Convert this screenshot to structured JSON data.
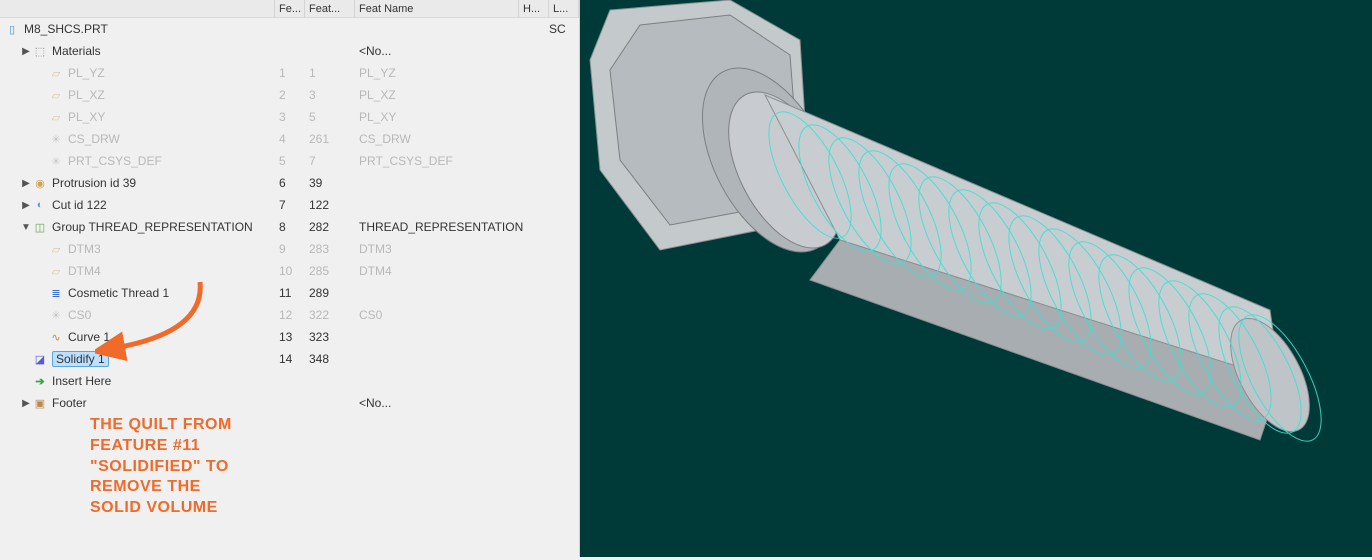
{
  "header": {
    "col_feat_num_abbrev": "Fe...",
    "col_feat_abbrev": "Feat...",
    "col_feat_name": "Feat Name",
    "col_h": "H...",
    "col_l": "L..."
  },
  "root": {
    "label": "M8_SHCS.PRT",
    "stat": "SC"
  },
  "tree": [
    {
      "id": "materials",
      "label": "Materials",
      "expand": "▶",
      "indent": 1,
      "icon": "mat",
      "dim": false,
      "c1": "",
      "c2": "",
      "c3": "<No...",
      "interactable": true
    },
    {
      "id": "pl_yz",
      "label": "PL_YZ",
      "expand": "",
      "indent": 2,
      "icon": "plane",
      "dim": true,
      "c1": "1",
      "c2": "1",
      "c3": "PL_YZ",
      "interactable": true
    },
    {
      "id": "pl_xz",
      "label": "PL_XZ",
      "expand": "",
      "indent": 2,
      "icon": "plane",
      "dim": true,
      "c1": "2",
      "c2": "3",
      "c3": "PL_XZ",
      "interactable": true
    },
    {
      "id": "pl_xy",
      "label": "PL_XY",
      "expand": "",
      "indent": 2,
      "icon": "plane",
      "dim": true,
      "c1": "3",
      "c2": "5",
      "c3": "PL_XY",
      "interactable": true
    },
    {
      "id": "cs_drw",
      "label": "CS_DRW",
      "expand": "",
      "indent": 2,
      "icon": "csys",
      "dim": true,
      "c1": "4",
      "c2": "261",
      "c3": "CS_DRW",
      "interactable": true
    },
    {
      "id": "prt_csys_def",
      "label": "PRT_CSYS_DEF",
      "expand": "",
      "indent": 2,
      "icon": "csys",
      "dim": true,
      "c1": "5",
      "c2": "7",
      "c3": "PRT_CSYS_DEF",
      "interactable": true
    },
    {
      "id": "protrusion39",
      "label": "Protrusion id 39",
      "expand": "▶",
      "indent": 1,
      "icon": "prot",
      "dim": false,
      "c1": "6",
      "c2": "39",
      "c3": "",
      "interactable": true
    },
    {
      "id": "cut122",
      "label": "Cut id 122",
      "expand": "▶",
      "indent": 1,
      "icon": "cut",
      "dim": false,
      "c1": "7",
      "c2": "122",
      "c3": "",
      "interactable": true
    },
    {
      "id": "group_thread",
      "label": "Group THREAD_REPRESENTATION",
      "expand": "▼",
      "indent": 1,
      "icon": "group",
      "dim": false,
      "c1": "8",
      "c2": "282",
      "c3": "THREAD_REPRESENTATION",
      "interactable": true
    },
    {
      "id": "dtm3",
      "label": "DTM3",
      "expand": "",
      "indent": 2,
      "icon": "plane",
      "dim": true,
      "c1": "9",
      "c2": "283",
      "c3": "DTM3",
      "interactable": true
    },
    {
      "id": "dtm4",
      "label": "DTM4",
      "expand": "",
      "indent": 2,
      "icon": "plane",
      "dim": true,
      "c1": "10",
      "c2": "285",
      "c3": "DTM4",
      "interactable": true
    },
    {
      "id": "cosmetic_thread1",
      "label": "Cosmetic Thread 1",
      "expand": "",
      "indent": 2,
      "icon": "thread",
      "dim": false,
      "c1": "11",
      "c2": "289",
      "c3": "",
      "interactable": true
    },
    {
      "id": "cs0",
      "label": "CS0",
      "expand": "",
      "indent": 2,
      "icon": "csys",
      "dim": true,
      "c1": "12",
      "c2": "322",
      "c3": "CS0",
      "interactable": true
    },
    {
      "id": "curve1",
      "label": "Curve 1",
      "expand": "",
      "indent": 2,
      "icon": "curve",
      "dim": false,
      "c1": "13",
      "c2": "323",
      "c3": "",
      "interactable": true
    },
    {
      "id": "solidify1",
      "label": "Solidify 1",
      "expand": "",
      "indent": 1,
      "icon": "solidify",
      "dim": false,
      "c1": "14",
      "c2": "348",
      "c3": "",
      "interactable": true,
      "selected": true
    },
    {
      "id": "insert_here",
      "label": "Insert Here",
      "expand": "",
      "indent": 1,
      "icon": "insert",
      "dim": false,
      "c1": "",
      "c2": "",
      "c3": "",
      "interactable": true
    },
    {
      "id": "footer",
      "label": "Footer",
      "expand": "▶",
      "indent": 1,
      "icon": "footer",
      "dim": false,
      "c1": "",
      "c2": "",
      "c3": "<No...",
      "interactable": true
    }
  ],
  "annotation": "THE QUILT FROM\nFEATURE #11\n\"SOLIDIFIED\" TO\nREMOVE THE\nSOLID VOLUME",
  "icons": {
    "mat": "⬚",
    "plane": "▱",
    "csys": "✳",
    "prot": "◉",
    "cut": "◐",
    "group": "◫",
    "thread": "≣",
    "curve": "∿",
    "solidify": "◪",
    "insert": "➔",
    "footer": "▣",
    "part": "▯"
  }
}
